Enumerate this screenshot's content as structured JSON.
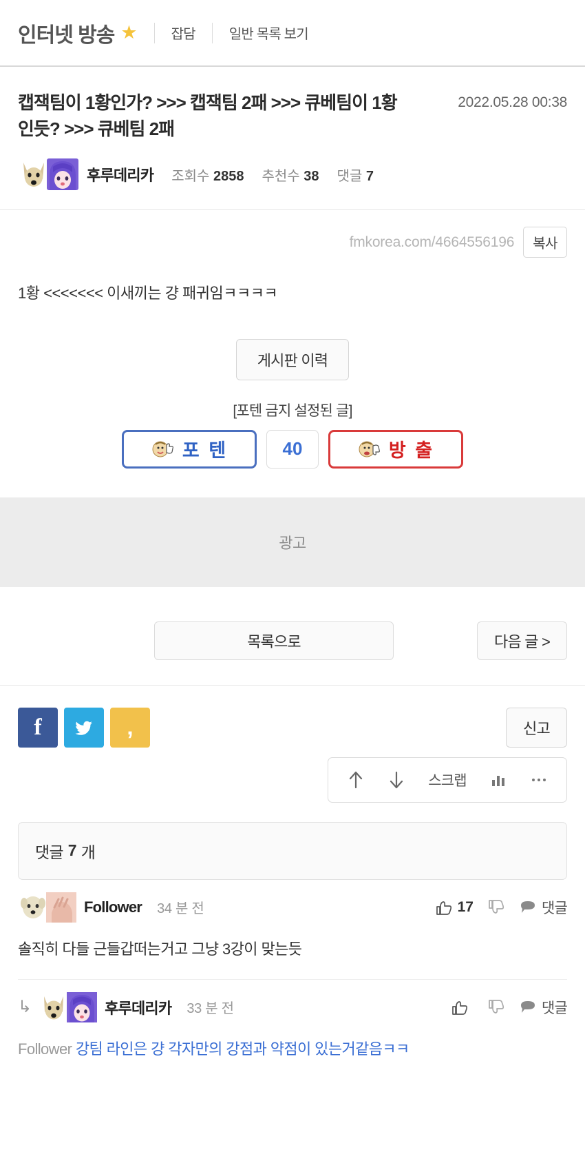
{
  "header": {
    "board_name": "인터넷 방송",
    "star_icon": "star-icon",
    "links": [
      "잡담",
      "일반 목록 보기"
    ]
  },
  "article": {
    "title": "캡잭팀이 1황인가? >>> 캡잭팀 2패 >>> 큐베팀이 1황인듯? >>> 큐베팀 2패",
    "date": "2022.05.28 00:38",
    "author": "후루데리카",
    "views_label": "조회수",
    "views": "2858",
    "likes_label": "추천수",
    "likes": "38",
    "comments_label": "댓글",
    "comments_count": "7",
    "url": "fmkorea.com/4664556196",
    "copy_button": "복사",
    "body": "1황 <<<<<<< 이새끼는 걍 패귀임ㅋㅋㅋㅋ"
  },
  "poten": {
    "history_button": "게시판 이력",
    "note": "[포텐 금지 설정된 글]",
    "up_label": "포 텐",
    "down_label": "방 출",
    "score": "40",
    "up_color": "#2f62c4",
    "down_color": "#d42020"
  },
  "ad": {
    "label": "광고"
  },
  "nav": {
    "list_button": "목록으로",
    "next_button": "다음 글 >"
  },
  "share": {
    "facebook": "f",
    "twitter": "twitter-icon",
    "kakao": "‚",
    "report_button": "신고"
  },
  "action_bar": {
    "up_icon": "arrow-up-icon",
    "down_icon": "arrow-down-icon",
    "scrap_label": "스크랩",
    "stats_icon": "chart-icon",
    "more_icon": "ellipsis-icon"
  },
  "comments": {
    "count_prefix": "댓글",
    "count": "7",
    "count_suffix": "개",
    "items": [
      {
        "author": "Follower",
        "time": "34 분 전",
        "likes": "17",
        "reply_label": "댓글",
        "text": "솔직히 다들 근들갑떠는거고 그냥 3강이 맞는듯",
        "is_reply": false,
        "mention": ""
      },
      {
        "author": "후루데리카",
        "time": "33 분 전",
        "likes": "",
        "reply_label": "댓글",
        "text": "강팀 라인은 걍 각자만의 강점과 약점이 있는거같음ㅋㅋ",
        "is_reply": true,
        "mention": "Follower"
      }
    ]
  }
}
